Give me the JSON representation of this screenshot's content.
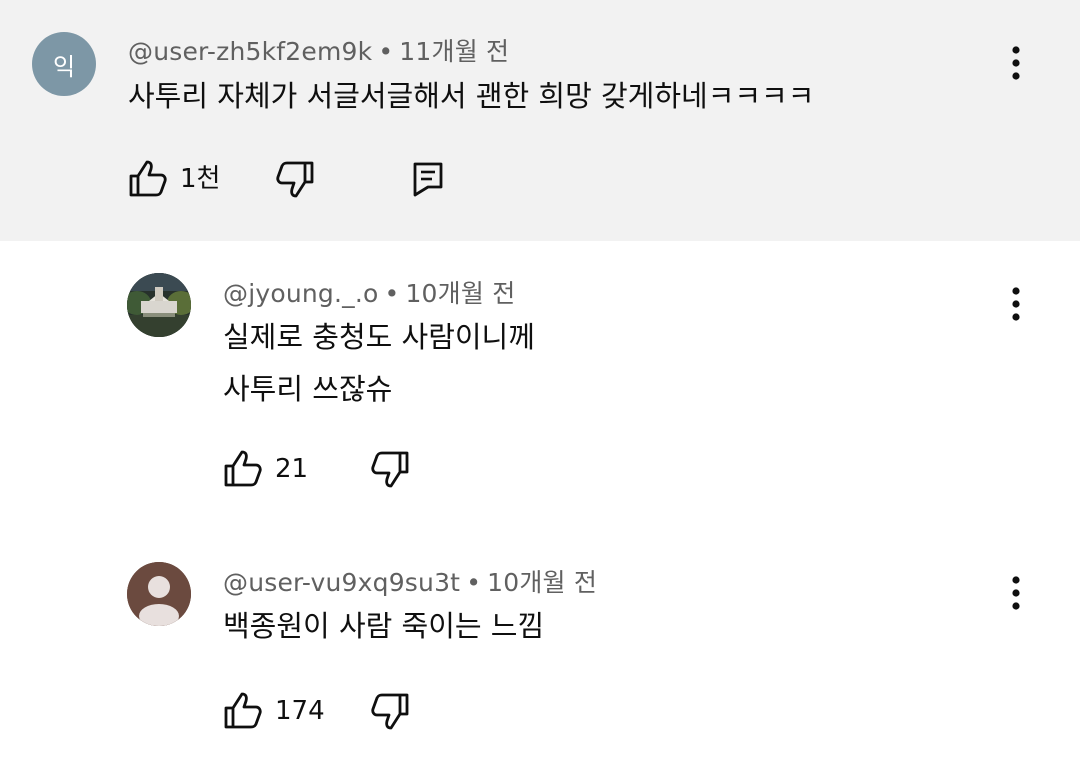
{
  "comments": [
    {
      "author": "@user-zh5kf2em9k",
      "time": "11개월 전",
      "avatar_letter": "익",
      "avatar_color": "#7d97a6",
      "lines": [
        "사투리 자체가 서글서글해서 괜한 희망 갖게하네ㅋㅋㅋㅋ"
      ],
      "likes": "1천",
      "highlighted": true
    },
    {
      "author": "@jyoung._.o",
      "time": "10개월 전",
      "lines": [
        "실제로 충청도 사람이니께",
        "사투리 쓰잖슈"
      ],
      "likes": "21"
    },
    {
      "author": "@user-vu9xq9su3t",
      "time": "10개월 전",
      "avatar_color": "#6b4a3f",
      "lines": [
        "백종원이 사람 죽이는 느낌"
      ],
      "likes": "174"
    }
  ],
  "meta_separator": "•"
}
